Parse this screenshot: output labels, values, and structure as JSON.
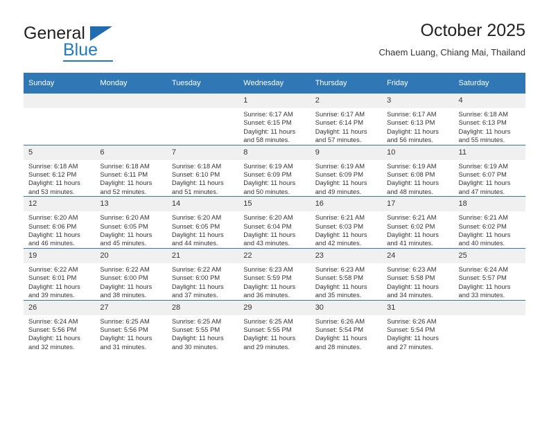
{
  "logo": {
    "word1": "General",
    "word2": "Blue",
    "triangle_color": "#1f6cb0",
    "blue_color": "#1f7ac0"
  },
  "header": {
    "title": "October 2025",
    "subtitle": "Chaem Luang, Chiang Mai, Thailand"
  },
  "calendar": {
    "header_bg": "#2f77b5",
    "daynum_bg": "#f0f0f0",
    "weekday_headers": [
      "Sunday",
      "Monday",
      "Tuesday",
      "Wednesday",
      "Thursday",
      "Friday",
      "Saturday"
    ],
    "labels": {
      "sunrise": "Sunrise:",
      "sunset": "Sunset:",
      "daylight": "Daylight:"
    },
    "weeks": [
      [
        {
          "day": "",
          "lines": []
        },
        {
          "day": "",
          "lines": []
        },
        {
          "day": "",
          "lines": []
        },
        {
          "day": "1",
          "lines": [
            "Sunrise: 6:17 AM",
            "Sunset: 6:15 PM",
            "Daylight: 11 hours",
            "and 58 minutes."
          ]
        },
        {
          "day": "2",
          "lines": [
            "Sunrise: 6:17 AM",
            "Sunset: 6:14 PM",
            "Daylight: 11 hours",
            "and 57 minutes."
          ]
        },
        {
          "day": "3",
          "lines": [
            "Sunrise: 6:17 AM",
            "Sunset: 6:13 PM",
            "Daylight: 11 hours",
            "and 56 minutes."
          ]
        },
        {
          "day": "4",
          "lines": [
            "Sunrise: 6:18 AM",
            "Sunset: 6:13 PM",
            "Daylight: 11 hours",
            "and 55 minutes."
          ]
        }
      ],
      [
        {
          "day": "5",
          "lines": [
            "Sunrise: 6:18 AM",
            "Sunset: 6:12 PM",
            "Daylight: 11 hours",
            "and 53 minutes."
          ]
        },
        {
          "day": "6",
          "lines": [
            "Sunrise: 6:18 AM",
            "Sunset: 6:11 PM",
            "Daylight: 11 hours",
            "and 52 minutes."
          ]
        },
        {
          "day": "7",
          "lines": [
            "Sunrise: 6:18 AM",
            "Sunset: 6:10 PM",
            "Daylight: 11 hours",
            "and 51 minutes."
          ]
        },
        {
          "day": "8",
          "lines": [
            "Sunrise: 6:19 AM",
            "Sunset: 6:09 PM",
            "Daylight: 11 hours",
            "and 50 minutes."
          ]
        },
        {
          "day": "9",
          "lines": [
            "Sunrise: 6:19 AM",
            "Sunset: 6:09 PM",
            "Daylight: 11 hours",
            "and 49 minutes."
          ]
        },
        {
          "day": "10",
          "lines": [
            "Sunrise: 6:19 AM",
            "Sunset: 6:08 PM",
            "Daylight: 11 hours",
            "and 48 minutes."
          ]
        },
        {
          "day": "11",
          "lines": [
            "Sunrise: 6:19 AM",
            "Sunset: 6:07 PM",
            "Daylight: 11 hours",
            "and 47 minutes."
          ]
        }
      ],
      [
        {
          "day": "12",
          "lines": [
            "Sunrise: 6:20 AM",
            "Sunset: 6:06 PM",
            "Daylight: 11 hours",
            "and 46 minutes."
          ]
        },
        {
          "day": "13",
          "lines": [
            "Sunrise: 6:20 AM",
            "Sunset: 6:05 PM",
            "Daylight: 11 hours",
            "and 45 minutes."
          ]
        },
        {
          "day": "14",
          "lines": [
            "Sunrise: 6:20 AM",
            "Sunset: 6:05 PM",
            "Daylight: 11 hours",
            "and 44 minutes."
          ]
        },
        {
          "day": "15",
          "lines": [
            "Sunrise: 6:20 AM",
            "Sunset: 6:04 PM",
            "Daylight: 11 hours",
            "and 43 minutes."
          ]
        },
        {
          "day": "16",
          "lines": [
            "Sunrise: 6:21 AM",
            "Sunset: 6:03 PM",
            "Daylight: 11 hours",
            "and 42 minutes."
          ]
        },
        {
          "day": "17",
          "lines": [
            "Sunrise: 6:21 AM",
            "Sunset: 6:02 PM",
            "Daylight: 11 hours",
            "and 41 minutes."
          ]
        },
        {
          "day": "18",
          "lines": [
            "Sunrise: 6:21 AM",
            "Sunset: 6:02 PM",
            "Daylight: 11 hours",
            "and 40 minutes."
          ]
        }
      ],
      [
        {
          "day": "19",
          "lines": [
            "Sunrise: 6:22 AM",
            "Sunset: 6:01 PM",
            "Daylight: 11 hours",
            "and 39 minutes."
          ]
        },
        {
          "day": "20",
          "lines": [
            "Sunrise: 6:22 AM",
            "Sunset: 6:00 PM",
            "Daylight: 11 hours",
            "and 38 minutes."
          ]
        },
        {
          "day": "21",
          "lines": [
            "Sunrise: 6:22 AM",
            "Sunset: 6:00 PM",
            "Daylight: 11 hours",
            "and 37 minutes."
          ]
        },
        {
          "day": "22",
          "lines": [
            "Sunrise: 6:23 AM",
            "Sunset: 5:59 PM",
            "Daylight: 11 hours",
            "and 36 minutes."
          ]
        },
        {
          "day": "23",
          "lines": [
            "Sunrise: 6:23 AM",
            "Sunset: 5:58 PM",
            "Daylight: 11 hours",
            "and 35 minutes."
          ]
        },
        {
          "day": "24",
          "lines": [
            "Sunrise: 6:23 AM",
            "Sunset: 5:58 PM",
            "Daylight: 11 hours",
            "and 34 minutes."
          ]
        },
        {
          "day": "25",
          "lines": [
            "Sunrise: 6:24 AM",
            "Sunset: 5:57 PM",
            "Daylight: 11 hours",
            "and 33 minutes."
          ]
        }
      ],
      [
        {
          "day": "26",
          "lines": [
            "Sunrise: 6:24 AM",
            "Sunset: 5:56 PM",
            "Daylight: 11 hours",
            "and 32 minutes."
          ]
        },
        {
          "day": "27",
          "lines": [
            "Sunrise: 6:25 AM",
            "Sunset: 5:56 PM",
            "Daylight: 11 hours",
            "and 31 minutes."
          ]
        },
        {
          "day": "28",
          "lines": [
            "Sunrise: 6:25 AM",
            "Sunset: 5:55 PM",
            "Daylight: 11 hours",
            "and 30 minutes."
          ]
        },
        {
          "day": "29",
          "lines": [
            "Sunrise: 6:25 AM",
            "Sunset: 5:55 PM",
            "Daylight: 11 hours",
            "and 29 minutes."
          ]
        },
        {
          "day": "30",
          "lines": [
            "Sunrise: 6:26 AM",
            "Sunset: 5:54 PM",
            "Daylight: 11 hours",
            "and 28 minutes."
          ]
        },
        {
          "day": "31",
          "lines": [
            "Sunrise: 6:26 AM",
            "Sunset: 5:54 PM",
            "Daylight: 11 hours",
            "and 27 minutes."
          ]
        },
        {
          "day": "",
          "lines": []
        }
      ]
    ]
  }
}
